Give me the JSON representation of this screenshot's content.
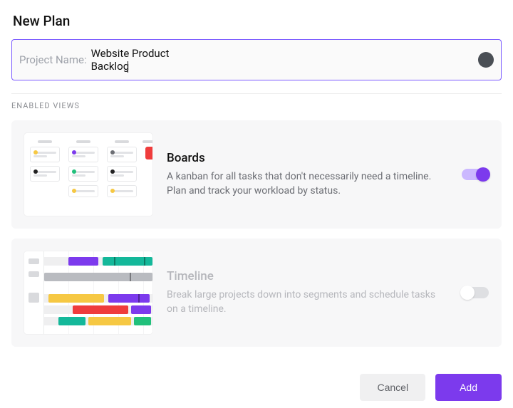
{
  "header": {
    "title": "New Plan"
  },
  "input": {
    "label": "Project Name:",
    "value": "Website Product Backlog"
  },
  "section_label": "ENABLED VIEWS",
  "views": {
    "boards": {
      "title": "Boards",
      "description": "A kanban for all tasks that don't necessarily need a timeline. Plan and track your workload by status.",
      "enabled": true
    },
    "timeline": {
      "title": "Timeline",
      "description": "Break large projects down into segments and schedule tasks on a timeline.",
      "enabled": false
    }
  },
  "footer": {
    "cancel_label": "Cancel",
    "add_label": "Add"
  }
}
